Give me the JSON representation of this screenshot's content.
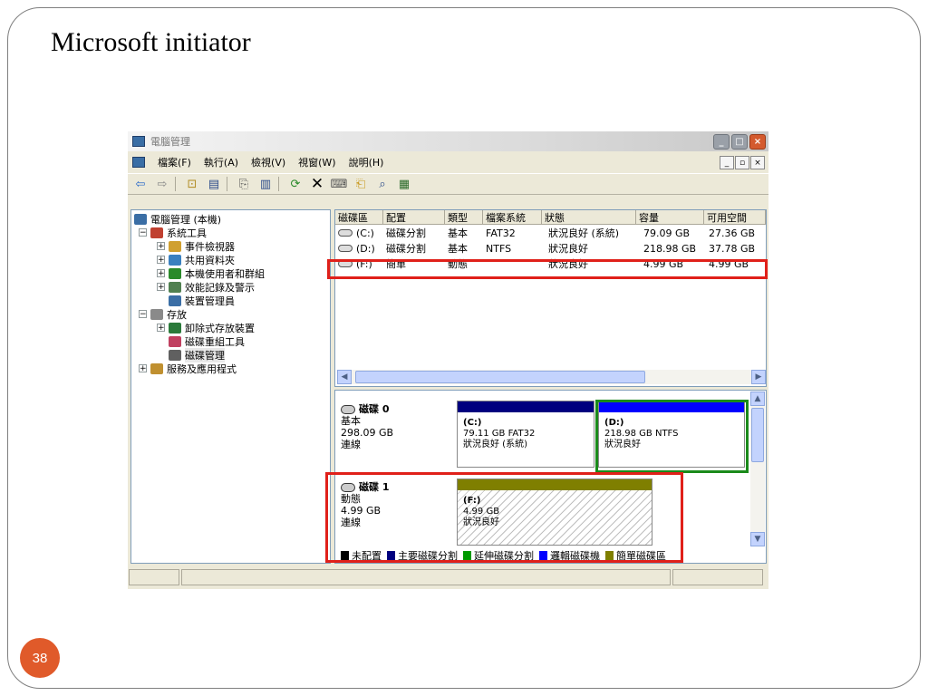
{
  "slide": {
    "title": "Microsoft initiator",
    "page_number": "38"
  },
  "window": {
    "title": "電腦管理",
    "menus": [
      "檔案(F)",
      "執行(A)",
      "檢視(V)",
      "視窗(W)",
      "說明(H)"
    ]
  },
  "tree": {
    "root": "電腦管理 (本機)",
    "system_tools": "系統工具",
    "event_viewer": "事件檢視器",
    "shared_folders": "共用資料夾",
    "local_users": "本機使用者和群組",
    "perf_logs": "效能記錄及警示",
    "device_manager": "裝置管理員",
    "storage": "存放",
    "removable_storage": "卸除式存放裝置",
    "defrag": "磁碟重組工具",
    "disk_mgmt": "磁碟管理",
    "services_apps": "服務及應用程式"
  },
  "volume_list": {
    "columns": [
      "磁碟區",
      "配置",
      "類型",
      "檔案系統",
      "狀態",
      "容量",
      "可用空間"
    ],
    "rows": [
      {
        "volume": "(C:)",
        "layout": "磁碟分割",
        "type": "基本",
        "fs": "FAT32",
        "status": "狀況良好 (系統)",
        "capacity": "79.09 GB",
        "free": "27.36 GB"
      },
      {
        "volume": "(D:)",
        "layout": "磁碟分割",
        "type": "基本",
        "fs": "NTFS",
        "status": "狀況良好",
        "capacity": "218.98 GB",
        "free": "37.78 GB"
      },
      {
        "volume": "(F:)",
        "layout": "簡單",
        "type": "動態",
        "fs": "",
        "status": "狀況良好",
        "capacity": "4.99 GB",
        "free": "4.99 GB"
      }
    ]
  },
  "disks": [
    {
      "name": "磁碟 0",
      "type": "基本",
      "size": "298.09 GB",
      "state": "連線",
      "volumes": [
        {
          "letter": "(C:)",
          "line1": "79.11 GB FAT32",
          "line2": "狀況良好 (系統)"
        },
        {
          "letter": "(D:)",
          "line1": "218.98 GB NTFS",
          "line2": "狀況良好"
        }
      ]
    },
    {
      "name": "磁碟 1",
      "type": "動態",
      "size": "4.99 GB",
      "state": "連線",
      "volumes": [
        {
          "letter": "(F:)",
          "line1": "4.99 GB",
          "line2": "狀況良好"
        }
      ]
    }
  ],
  "legend": {
    "unallocated": "未配置",
    "primary": "主要磁碟分割",
    "extended": "延伸磁碟分割",
    "logical": "邏輯磁碟機",
    "simple": "簡單磁碟區"
  },
  "colors": {
    "primary": "#00007f",
    "logical": "#0000ff",
    "extended": "#009900",
    "simple": "#7f7f00",
    "unallocated": "#000000",
    "highlight_red": "#e0201a",
    "highlight_green": "#1a8a1a",
    "badge": "#e05a2a"
  }
}
